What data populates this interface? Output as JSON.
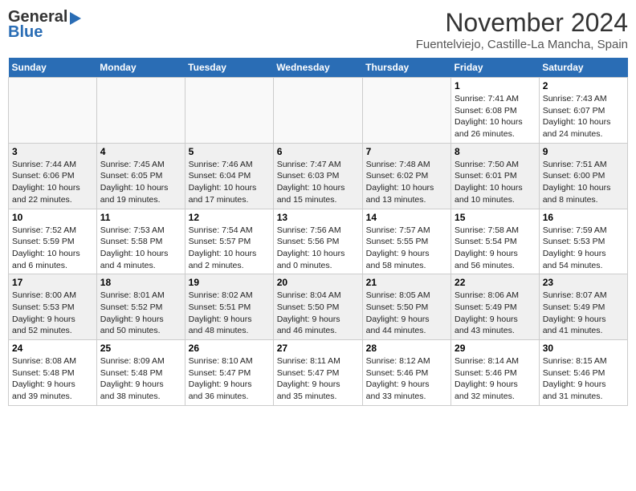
{
  "header": {
    "logo_general": "General",
    "logo_blue": "Blue",
    "month": "November 2024",
    "location": "Fuentelviejo, Castille-La Mancha, Spain"
  },
  "weekdays": [
    "Sunday",
    "Monday",
    "Tuesday",
    "Wednesday",
    "Thursday",
    "Friday",
    "Saturday"
  ],
  "weeks": [
    [
      {
        "day": "",
        "info": "",
        "empty": true
      },
      {
        "day": "",
        "info": "",
        "empty": true
      },
      {
        "day": "",
        "info": "",
        "empty": true
      },
      {
        "day": "",
        "info": "",
        "empty": true
      },
      {
        "day": "",
        "info": "",
        "empty": true
      },
      {
        "day": "1",
        "info": "Sunrise: 7:41 AM\nSunset: 6:08 PM\nDaylight: 10 hours\nand 26 minutes."
      },
      {
        "day": "2",
        "info": "Sunrise: 7:43 AM\nSunset: 6:07 PM\nDaylight: 10 hours\nand 24 minutes."
      }
    ],
    [
      {
        "day": "3",
        "info": "Sunrise: 7:44 AM\nSunset: 6:06 PM\nDaylight: 10 hours\nand 22 minutes."
      },
      {
        "day": "4",
        "info": "Sunrise: 7:45 AM\nSunset: 6:05 PM\nDaylight: 10 hours\nand 19 minutes."
      },
      {
        "day": "5",
        "info": "Sunrise: 7:46 AM\nSunset: 6:04 PM\nDaylight: 10 hours\nand 17 minutes."
      },
      {
        "day": "6",
        "info": "Sunrise: 7:47 AM\nSunset: 6:03 PM\nDaylight: 10 hours\nand 15 minutes."
      },
      {
        "day": "7",
        "info": "Sunrise: 7:48 AM\nSunset: 6:02 PM\nDaylight: 10 hours\nand 13 minutes."
      },
      {
        "day": "8",
        "info": "Sunrise: 7:50 AM\nSunset: 6:01 PM\nDaylight: 10 hours\nand 10 minutes."
      },
      {
        "day": "9",
        "info": "Sunrise: 7:51 AM\nSunset: 6:00 PM\nDaylight: 10 hours\nand 8 minutes."
      }
    ],
    [
      {
        "day": "10",
        "info": "Sunrise: 7:52 AM\nSunset: 5:59 PM\nDaylight: 10 hours\nand 6 minutes."
      },
      {
        "day": "11",
        "info": "Sunrise: 7:53 AM\nSunset: 5:58 PM\nDaylight: 10 hours\nand 4 minutes."
      },
      {
        "day": "12",
        "info": "Sunrise: 7:54 AM\nSunset: 5:57 PM\nDaylight: 10 hours\nand 2 minutes."
      },
      {
        "day": "13",
        "info": "Sunrise: 7:56 AM\nSunset: 5:56 PM\nDaylight: 10 hours\nand 0 minutes."
      },
      {
        "day": "14",
        "info": "Sunrise: 7:57 AM\nSunset: 5:55 PM\nDaylight: 9 hours\nand 58 minutes."
      },
      {
        "day": "15",
        "info": "Sunrise: 7:58 AM\nSunset: 5:54 PM\nDaylight: 9 hours\nand 56 minutes."
      },
      {
        "day": "16",
        "info": "Sunrise: 7:59 AM\nSunset: 5:53 PM\nDaylight: 9 hours\nand 54 minutes."
      }
    ],
    [
      {
        "day": "17",
        "info": "Sunrise: 8:00 AM\nSunset: 5:53 PM\nDaylight: 9 hours\nand 52 minutes."
      },
      {
        "day": "18",
        "info": "Sunrise: 8:01 AM\nSunset: 5:52 PM\nDaylight: 9 hours\nand 50 minutes."
      },
      {
        "day": "19",
        "info": "Sunrise: 8:02 AM\nSunset: 5:51 PM\nDaylight: 9 hours\nand 48 minutes."
      },
      {
        "day": "20",
        "info": "Sunrise: 8:04 AM\nSunset: 5:50 PM\nDaylight: 9 hours\nand 46 minutes."
      },
      {
        "day": "21",
        "info": "Sunrise: 8:05 AM\nSunset: 5:50 PM\nDaylight: 9 hours\nand 44 minutes."
      },
      {
        "day": "22",
        "info": "Sunrise: 8:06 AM\nSunset: 5:49 PM\nDaylight: 9 hours\nand 43 minutes."
      },
      {
        "day": "23",
        "info": "Sunrise: 8:07 AM\nSunset: 5:49 PM\nDaylight: 9 hours\nand 41 minutes."
      }
    ],
    [
      {
        "day": "24",
        "info": "Sunrise: 8:08 AM\nSunset: 5:48 PM\nDaylight: 9 hours\nand 39 minutes."
      },
      {
        "day": "25",
        "info": "Sunrise: 8:09 AM\nSunset: 5:48 PM\nDaylight: 9 hours\nand 38 minutes."
      },
      {
        "day": "26",
        "info": "Sunrise: 8:10 AM\nSunset: 5:47 PM\nDaylight: 9 hours\nand 36 minutes."
      },
      {
        "day": "27",
        "info": "Sunrise: 8:11 AM\nSunset: 5:47 PM\nDaylight: 9 hours\nand 35 minutes."
      },
      {
        "day": "28",
        "info": "Sunrise: 8:12 AM\nSunset: 5:46 PM\nDaylight: 9 hours\nand 33 minutes."
      },
      {
        "day": "29",
        "info": "Sunrise: 8:14 AM\nSunset: 5:46 PM\nDaylight: 9 hours\nand 32 minutes."
      },
      {
        "day": "30",
        "info": "Sunrise: 8:15 AM\nSunset: 5:46 PM\nDaylight: 9 hours\nand 31 minutes."
      }
    ]
  ]
}
